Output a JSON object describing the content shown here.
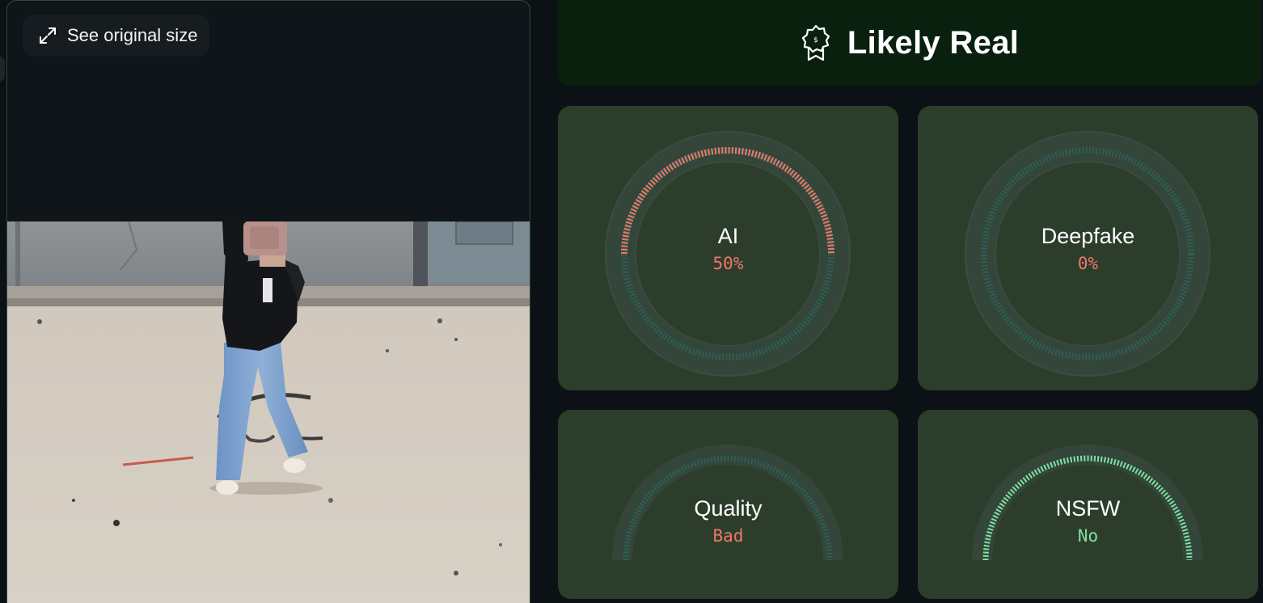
{
  "image_panel": {
    "see_original_label": "See original size",
    "expand_icon": "expand-arrows-icon"
  },
  "verdict": {
    "icon": "award-badge-icon",
    "text": "Likely Real",
    "background": "#0a200f"
  },
  "colors": {
    "danger": "#f07766",
    "safe": "#7fe0a0",
    "track": "#2e5e55",
    "card": "#2d3d2c"
  },
  "gauges": {
    "ai": {
      "label": "AI",
      "value": "50%",
      "level": 0.5,
      "status": "danger"
    },
    "deepfake": {
      "label": "Deepfake",
      "value": "0%",
      "level": 0,
      "status": "danger"
    },
    "quality": {
      "label": "Quality",
      "value": "Bad",
      "level": 0,
      "status": "danger"
    },
    "nsfw": {
      "label": "NSFW",
      "value": "No",
      "level": 1,
      "status": "safe"
    }
  }
}
